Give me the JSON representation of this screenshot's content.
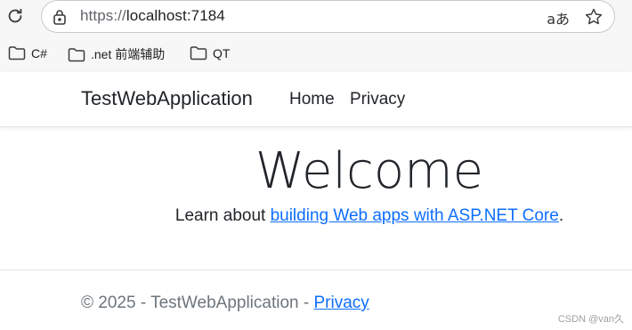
{
  "browser": {
    "url_protocol": "https://",
    "url_host": "localhost:7184",
    "translate_label": "aあ",
    "bookmarks": [
      {
        "label": "C#"
      },
      {
        "label": ".net 前端辅助"
      },
      {
        "label": "QT"
      }
    ]
  },
  "navbar": {
    "brand": "TestWebApplication",
    "links": [
      {
        "label": "Home"
      },
      {
        "label": "Privacy"
      }
    ]
  },
  "main": {
    "heading": "Welcome",
    "text_before": "Learn about ",
    "link_text": "building Web apps with ASP.NET Core",
    "text_after": "."
  },
  "footer": {
    "text": "© 2025 - TestWebApplication - ",
    "link_text": "Privacy"
  },
  "watermark": "CSDN @van久",
  "colors": {
    "link": "#0d6efd",
    "footer_text": "#6c757d",
    "chrome_bg": "#f7f7f7"
  }
}
